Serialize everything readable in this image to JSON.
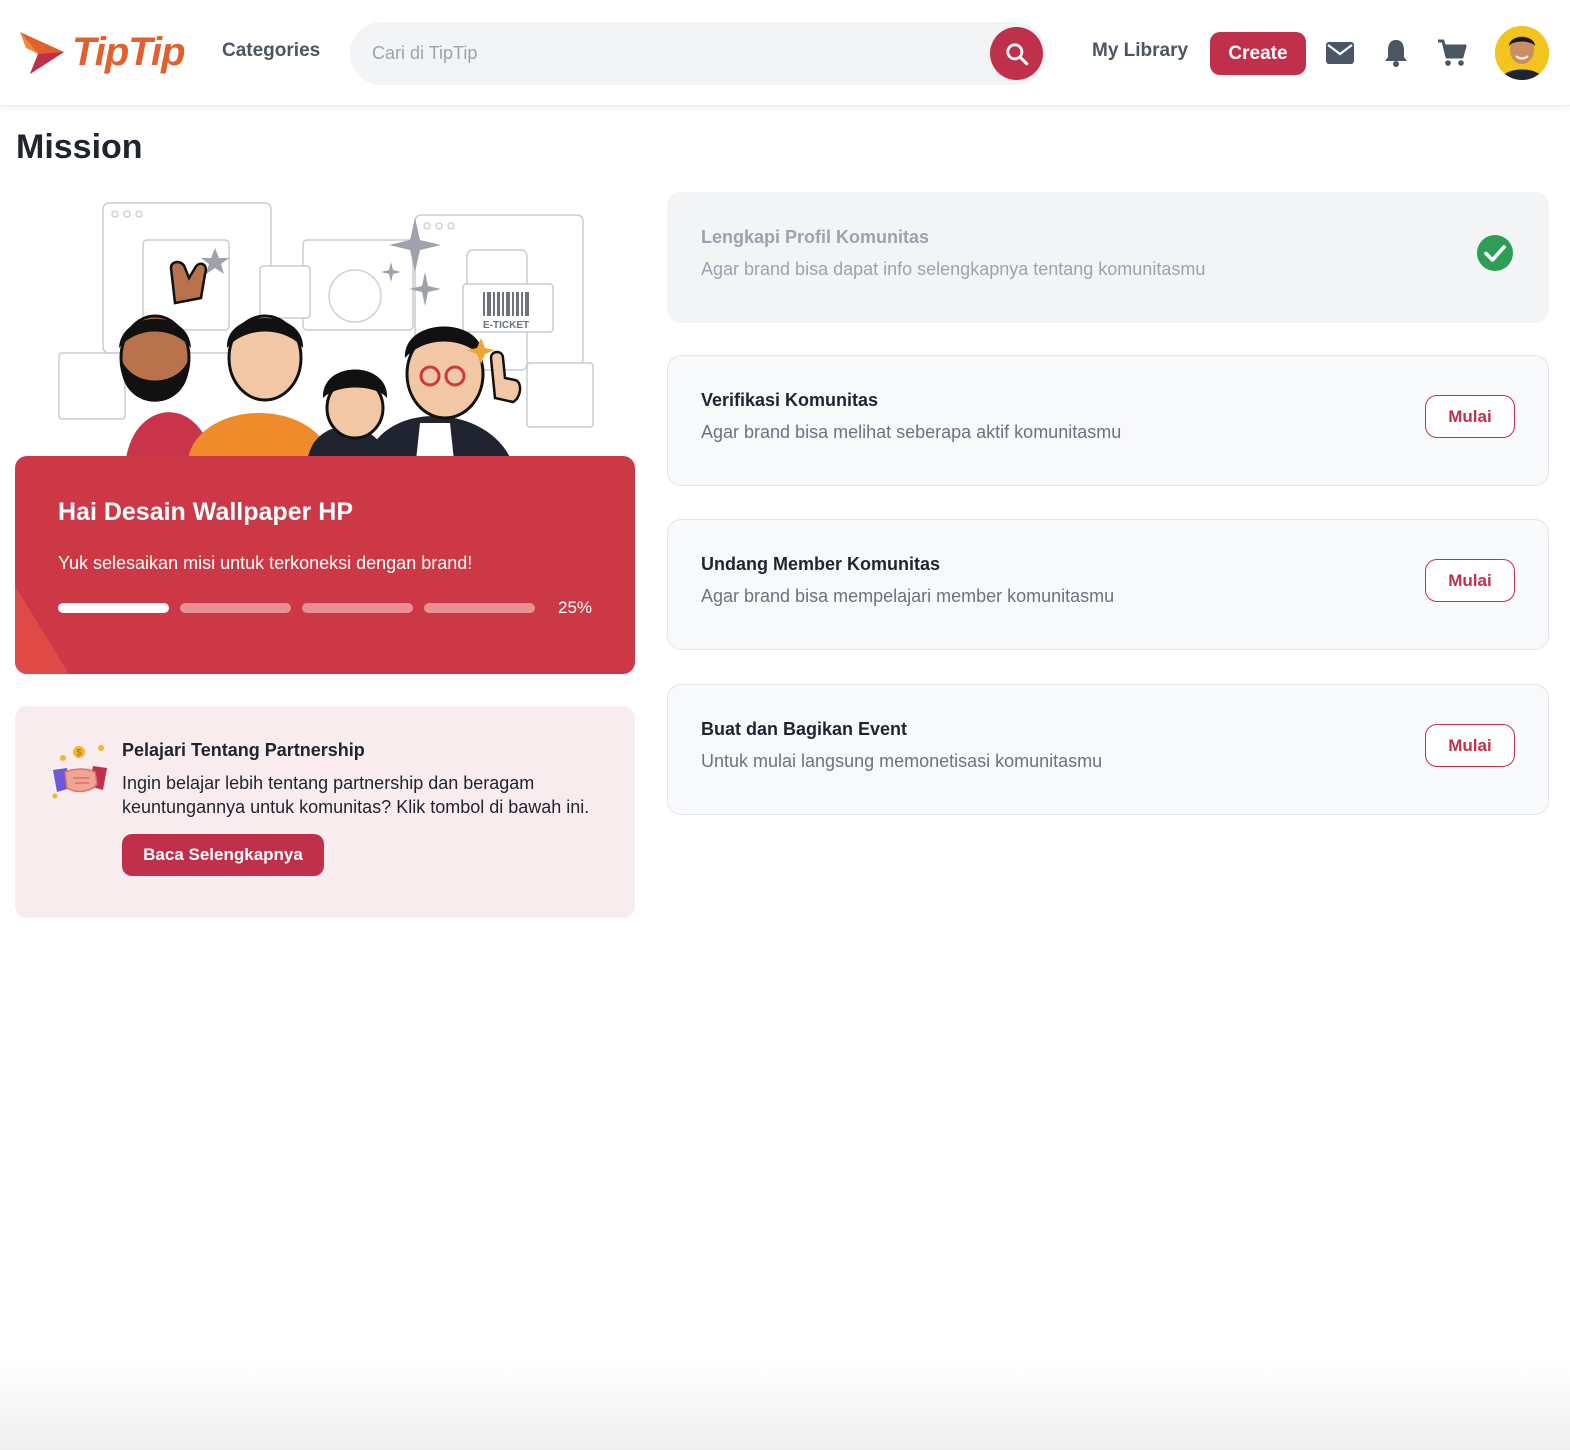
{
  "header": {
    "logo_text": "TipTip",
    "categories_label": "Categories",
    "search_placeholder": "Cari di TipTip",
    "my_library_label": "My Library",
    "create_label": "Create",
    "icons": [
      "search-icon",
      "mail-icon",
      "bell-icon",
      "cart-icon"
    ]
  },
  "page": {
    "title": "Mission"
  },
  "hero": {
    "title": "Hai Desain Wallpaper HP",
    "subtitle": "Yuk selesaikan misi untuk terkoneksi dengan brand!",
    "progress_text": "25%",
    "progress_fraction": 0.25,
    "progress_segments": 4,
    "progress_completed": 1,
    "illustration_text": "E-TICKET"
  },
  "partnership": {
    "title": "Pelajari Tentang Partnership",
    "text": "Ingin belajar lebih tentang partnership dan beragam keuntungannya untuk komunitas? Klik tombol di bawah ini.",
    "button_label": "Baca Selengkapnya"
  },
  "missions": [
    {
      "title": "Lengkapi Profil Komunitas",
      "desc": "Agar brand bisa dapat info selengkapnya tentang komunitasmu",
      "status": "completed"
    },
    {
      "title": "Verifikasi Komunitas",
      "desc": "Agar brand bisa melihat seberapa aktif komunitasmu",
      "status": "pending",
      "button_label": "Mulai"
    },
    {
      "title": "Undang Member Komunitas",
      "desc": "Agar brand bisa mempelajari member komunitasmu",
      "status": "pending",
      "button_label": "Mulai"
    },
    {
      "title": "Buat dan Bagikan Event",
      "desc": "Untuk mulai langsung memonetisasi komunitasmu",
      "status": "pending",
      "button_label": "Mulai"
    }
  ],
  "colors": {
    "brand": "#c0304b",
    "hero_bg": "#cc3845",
    "logo": "#e0602f",
    "success": "#2e9e57",
    "partner_bg": "#f9ecef"
  }
}
